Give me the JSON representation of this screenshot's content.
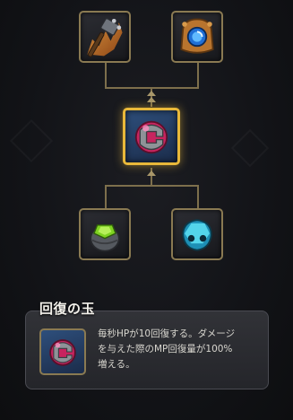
{
  "item_tree": {
    "top_items": [
      {
        "name": "spiked-hammer-item-icon"
      },
      {
        "name": "blue-orb-pack-item-icon"
      }
    ],
    "selected_item": {
      "name": "pink-orb-item-icon"
    },
    "bottom_items": [
      {
        "name": "green-gem-stone-item-icon"
      },
      {
        "name": "blue-crystal-item-icon"
      }
    ],
    "colors": {
      "connector": "#7d6f4c",
      "selected_border": "#e8b83a",
      "slot_border": "#8a7a52"
    }
  },
  "tooltip": {
    "title": "回復の玉",
    "description_lines": [
      "毎秒HPが10回復する。ダメージ",
      "を与えた際のMP回復量が100%",
      "増える。"
    ]
  }
}
